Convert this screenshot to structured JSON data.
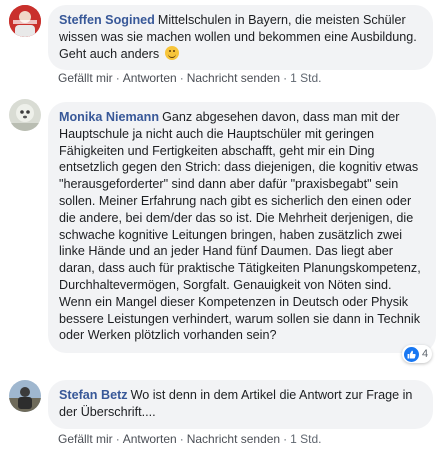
{
  "comments": [
    {
      "author": "Steffen Sogined",
      "text": "Mittelschulen in Bayern, die meisten Schüler wissen was sie machen wollen und bekommen eine Ausbildung. Geht auch anders",
      "emoji": "smiling-face-emoji",
      "actions": {
        "like": "Gefällt mir",
        "reply": "Antworten",
        "message": "Nachricht senden",
        "time": "1 Std."
      }
    },
    {
      "author": "Monika Niemann",
      "text": "Ganz abgesehen davon, dass man mit der Hauptschule ja nicht auch die Hauptschüler mit geringen Fähigkeiten und Fertigkeiten abschafft, geht mir ein Ding entsetzlich gegen den Strich: dass diejenigen, die kognitiv etwas \"herausgeforderter\" sind dann aber dafür \"praxisbegabt\" sein sollen. Meiner Erfahrung nach gibt es sicherlich den einen oder die andere, bei dem/der das so ist. Die Mehrheit derjenigen, die schwache kognitive Leitungen bringen, haben zusätzlich zwei linke Hände und an jeder Hand fünf Daumen. Das liegt aber daran, dass auch für praktische Tätigkeiten Planungskompetenz, Durchhaltevermögen, Sorgfalt. Genauigkeit von Nöten sind. Wenn ein Mangel dieser Kompetenzen in Deutsch oder Physik bessere Leistungen verhindert, warum sollen sie dann in Technik oder Werken plötzlich vorhanden sein?",
      "reactions": {
        "icon": "like-icon",
        "count": "4"
      }
    },
    {
      "author": "Stefan Betz",
      "text": "Wo ist denn in dem Artikel die Antwort zur Frage in der Überschrift....",
      "actions": {
        "like": "Gefällt mir",
        "reply": "Antworten",
        "message": "Nachricht senden",
        "time": "1 Std."
      }
    }
  ],
  "colors": {
    "author": "#385898",
    "bubble": "#f2f3f5",
    "like": "#1877f2"
  }
}
